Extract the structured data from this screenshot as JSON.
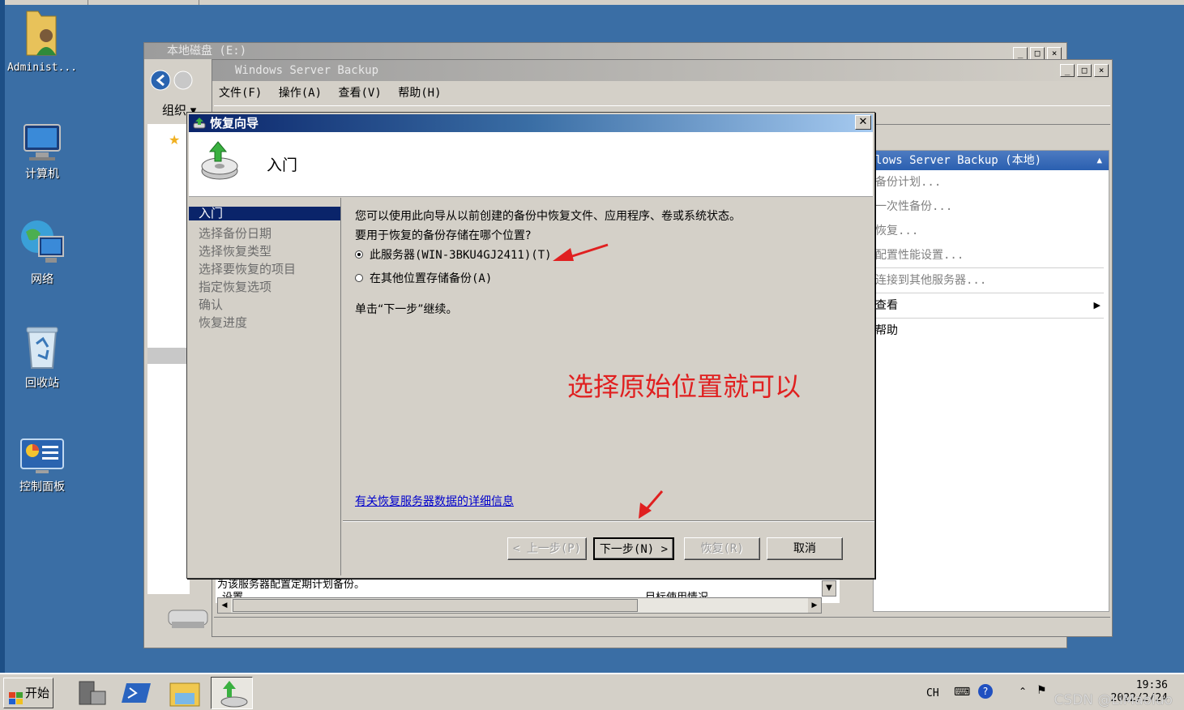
{
  "desktop": {
    "icons": [
      {
        "label": "Administ...",
        "icon": "user-folder-icon"
      },
      {
        "label": "计算机",
        "icon": "computer-icon"
      },
      {
        "label": "网络",
        "icon": "network-icon"
      },
      {
        "label": "回收站",
        "icon": "recycle-bin-icon"
      },
      {
        "label": "控制面板",
        "icon": "control-panel-icon"
      }
    ]
  },
  "explorer_window": {
    "title": "本地磁盘 (E:)",
    "organize_label": "组织"
  },
  "wsb_window": {
    "title": "Windows Server Backup",
    "menu": [
      "文件(F)",
      "操作(A)",
      "查看(V)",
      "帮助(H)"
    ],
    "bottom_text_1": "为该服务器配置定期计划备份。",
    "bottom_text_2": "设置",
    "bottom_text_3": "目标使用情况",
    "actions_panel": {
      "header": "lows Server Backup (本地)",
      "items": [
        "备份计划...",
        "一次性备份...",
        "恢复...",
        "配置性能设置...",
        "连接到其他服务器...",
        "查看",
        "帮助"
      ]
    }
  },
  "dialog": {
    "title": "恢复向导",
    "heading": "入门",
    "steps": [
      "入门",
      "选择备份日期",
      "选择恢复类型",
      "选择要恢复的项目",
      "指定恢复选项",
      "确认",
      "恢复进度"
    ],
    "active_step": 0,
    "intro": "您可以使用此向导从以前创建的备份中恢复文件、应用程序、卷或系统状态。",
    "question": "要用于恢复的备份存储在哪个位置?",
    "options": [
      {
        "label": "此服务器(WIN-3BKU4GJ2411)(T)",
        "selected": true
      },
      {
        "label": "在其他位置存储备份(A)",
        "selected": false
      }
    ],
    "continue_text": "单击“下一步”继续。",
    "help_link": "有关恢复服务器数据的详细信息",
    "buttons": {
      "back": "< 上一步(P)",
      "next": "下一步(N) >",
      "recover": "恢复(R)",
      "cancel": "取消"
    },
    "annotation": "选择原始位置就可以"
  },
  "taskbar": {
    "start_label": "开始",
    "language": "CH",
    "time": "19:36",
    "date": "2022/2/24",
    "watermark": "CSDN @LiMaoluo"
  },
  "colors": {
    "desktop": "#3a6ea5",
    "dialog_title": "#0a246a",
    "annotation": "#e02020"
  }
}
